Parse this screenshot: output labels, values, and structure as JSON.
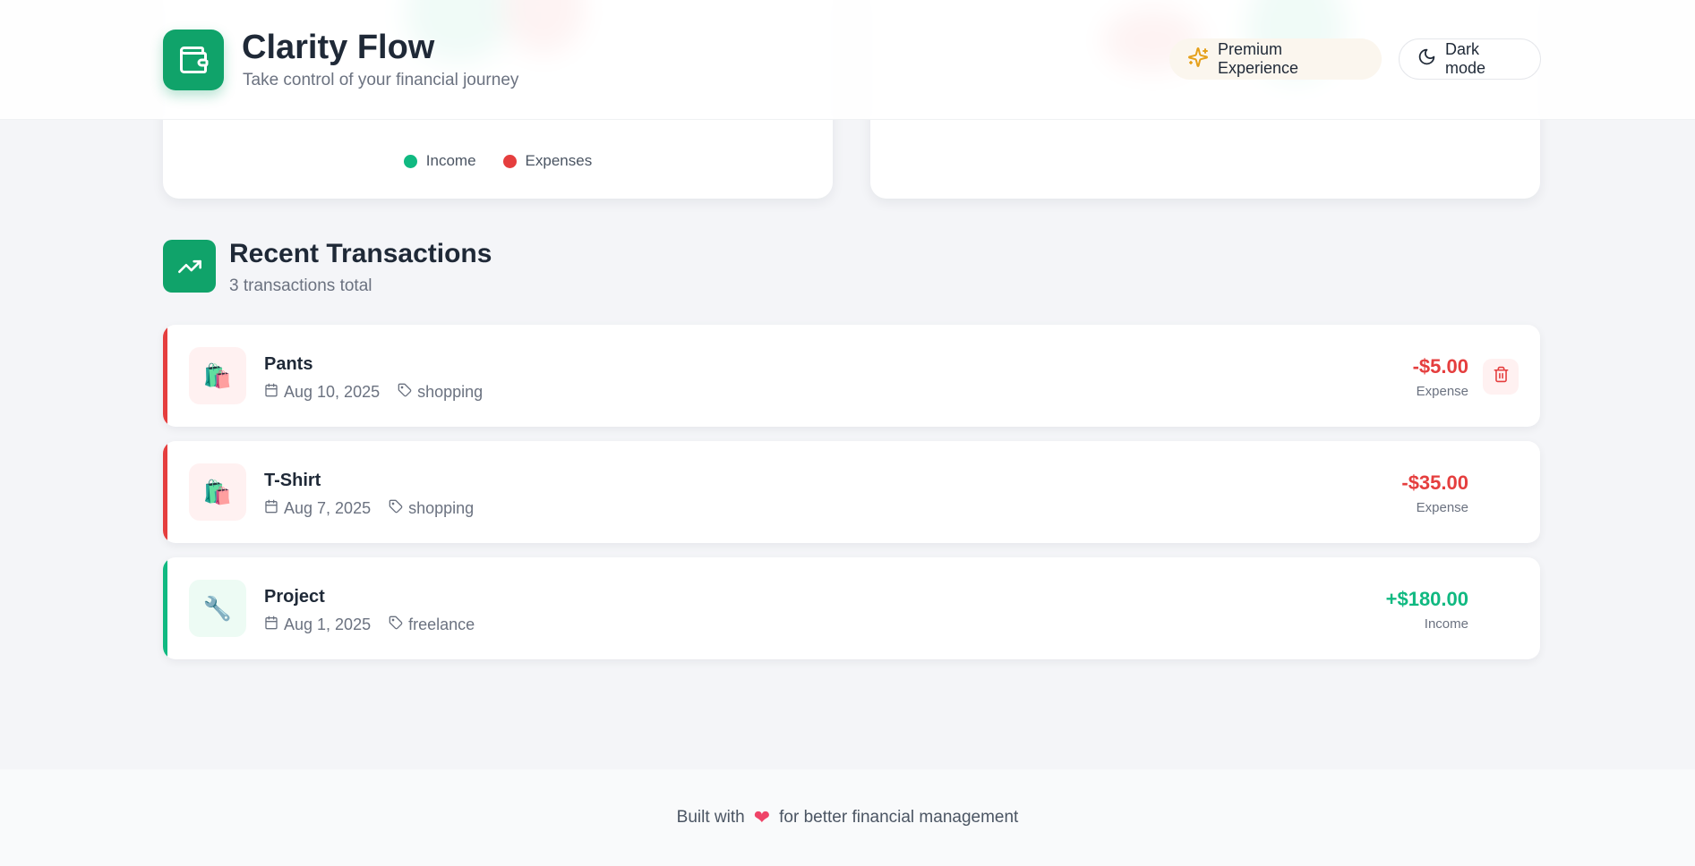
{
  "app": {
    "title": "Clarity Flow",
    "subtitle": "Take control of your financial journey"
  },
  "header_actions": {
    "premium_label": "Premium Experience",
    "dark_mode_label": "Dark mode"
  },
  "chart_legend": {
    "income_label": "Income",
    "expenses_label": "Expenses",
    "income_color": "#10b981",
    "expenses_color": "#e53e3e"
  },
  "recent": {
    "title": "Recent Transactions",
    "count_text": "3 transactions total",
    "transactions": [
      {
        "name": "Pants",
        "date": "Aug 10, 2025",
        "category": "shopping",
        "amount": "-$5.00",
        "kind": "Expense",
        "icon": "shopping-bags-icon"
      },
      {
        "name": "T-Shirt",
        "date": "Aug 7, 2025",
        "category": "shopping",
        "amount": "-$35.00",
        "kind": "Expense",
        "icon": "shopping-bags-icon"
      },
      {
        "name": "Project",
        "date": "Aug 1, 2025",
        "category": "freelance",
        "amount": "+$180.00",
        "kind": "Income",
        "icon": "wrench-icon"
      }
    ]
  },
  "footer": {
    "before": "Built with",
    "after": "for better financial management"
  },
  "colors": {
    "brand": "#10a36a",
    "expense": "#e53e3e",
    "income": "#10b981"
  }
}
